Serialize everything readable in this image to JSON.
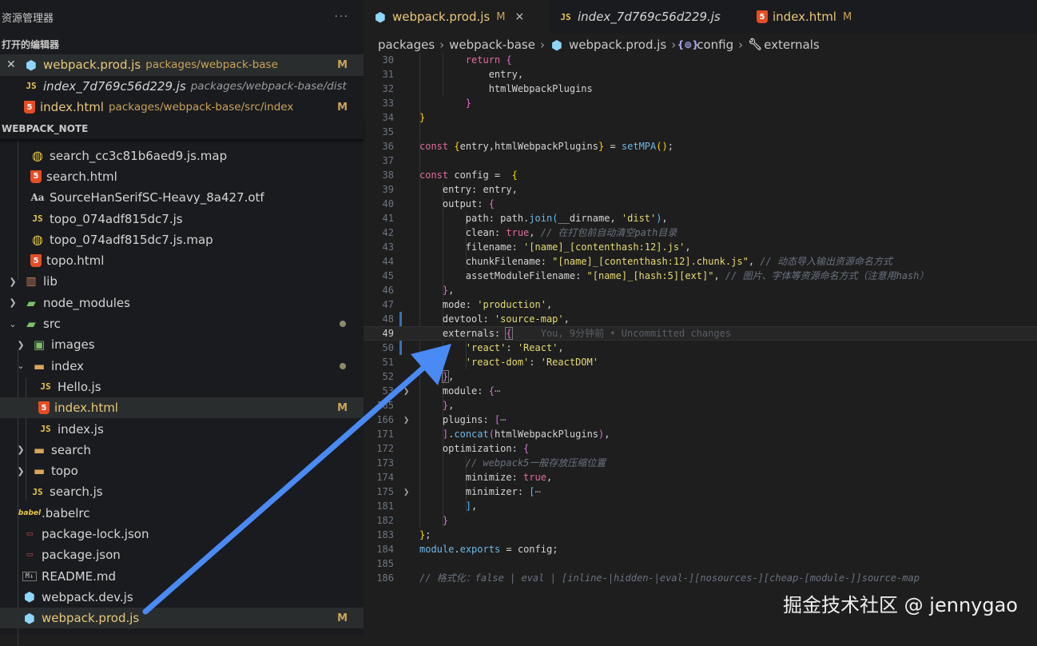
{
  "explorer": {
    "title": "资源管理器",
    "more": "···",
    "open_editors_title": "打开的编辑器",
    "open_editors": [
      {
        "name": "webpack.prod.js",
        "path": "packages/webpack-base",
        "badge": "M",
        "icon": "webpack-icon"
      },
      {
        "name": "index_7d769c56d229.js",
        "path": "packages/webpack-base/dist",
        "badge": "",
        "icon": "js-icon"
      },
      {
        "name": "index.html",
        "path": "packages/webpack-base/src/index",
        "badge": "M",
        "icon": "html-icon"
      }
    ],
    "project_title": "WEBPACK_NOTE",
    "tree": [
      {
        "name": "search_cc3c81b6aed9.js.map",
        "icon": "map-icon"
      },
      {
        "name": "search.html",
        "icon": "html-icon"
      },
      {
        "name": "SourceHanSerifSC-Heavy_8a427.otf",
        "icon": "font-icon"
      },
      {
        "name": "topo_074adf815dc7.js",
        "icon": "js-icon"
      },
      {
        "name": "topo_074adf815dc7.js.map",
        "icon": "map-icon"
      },
      {
        "name": "topo.html",
        "icon": "html-icon"
      },
      {
        "name": "lib",
        "icon": "folder-icon"
      },
      {
        "name": "node_modules",
        "icon": "folder-icon"
      },
      {
        "name": "src",
        "icon": "folder-icon"
      },
      {
        "name": "images",
        "icon": "folder-icon"
      },
      {
        "name": "index",
        "icon": "folder-open-icon"
      },
      {
        "name": "Hello.js",
        "icon": "js-icon"
      },
      {
        "name": "index.html",
        "icon": "html-icon",
        "badge": "M"
      },
      {
        "name": "index.js",
        "icon": "js-icon"
      },
      {
        "name": "search",
        "icon": "folder-icon"
      },
      {
        "name": "topo",
        "icon": "folder-icon"
      },
      {
        "name": "search.js",
        "icon": "js-icon"
      },
      {
        "name": ".babelrc",
        "icon": "babel-icon"
      },
      {
        "name": "package-lock.json",
        "icon": "json-icon"
      },
      {
        "name": "package.json",
        "icon": "json-icon"
      },
      {
        "name": "README.md",
        "icon": "markdown-icon"
      },
      {
        "name": "webpack.dev.js",
        "icon": "webpack-icon"
      },
      {
        "name": "webpack.prod.js",
        "icon": "webpack-icon",
        "badge": "M"
      }
    ]
  },
  "tabs": [
    {
      "name": "webpack.prod.js",
      "badge": "M",
      "close": "×"
    },
    {
      "name": "index_7d769c56d229.js",
      "badge": ""
    },
    {
      "name": "index.html",
      "badge": "M"
    }
  ],
  "breadcrumb": [
    "packages",
    "webpack-base",
    "webpack.prod.js",
    "config",
    "externals"
  ],
  "code": {
    "lines": [
      "30",
      "31",
      "32",
      "33",
      "34",
      "35",
      "36",
      "37",
      "38",
      "39",
      "40",
      "41",
      "42",
      "43",
      "44",
      "45",
      "46",
      "47",
      "48",
      "49",
      "50",
      "51",
      "52",
      "53",
      "165",
      "166",
      "171",
      "172",
      "173",
      "174",
      "175",
      "181",
      "182",
      "183",
      "184",
      "185",
      "186"
    ],
    "blame": "You, 9分钟前 • Uncommitted changes",
    "comment_clean": "// 在打包前自动清空path目录",
    "comment_chunk": "// 动态导入输出资源命名方式",
    "comment_asset": "// 图片、字体等资源命名方式（注意用hash）",
    "comment_opt": "// webpack5一般存放压缩位置",
    "comment_devtool": "// 格式化：false | eval | [inline-|hidden-|eval-][nosources-][cheap-[module-]]source-map"
  },
  "watermark": "掘金技术社区 @ jennygao",
  "colors": {
    "accent": "#4a8af4",
    "modified": "#c9a35a"
  }
}
